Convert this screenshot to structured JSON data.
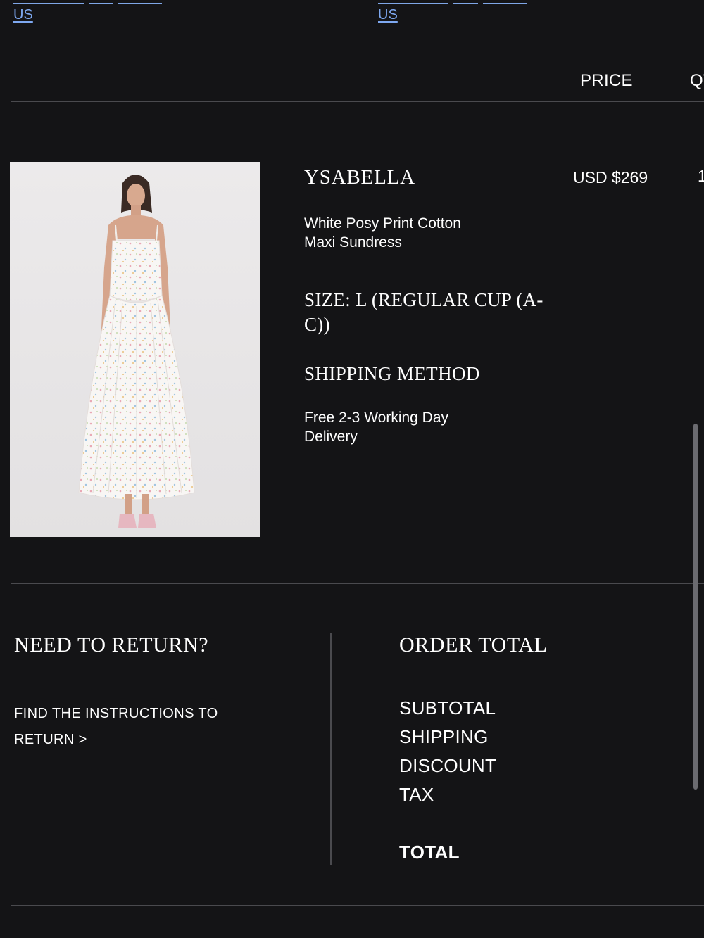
{
  "top_links": [
    "US",
    "US"
  ],
  "table_header": {
    "price": "PRICE",
    "qty": "QT"
  },
  "item": {
    "name": "YSABELLA",
    "description": "White Posy Print Cotton Maxi Sundress",
    "size": "SIZE: L (REGULAR CUP (A-C))",
    "shipping_method_label": "SHIPPING METHOD",
    "shipping_method_value": "Free 2-3 Working Day Delivery",
    "price": "USD $269",
    "qty": "1"
  },
  "returns": {
    "heading": "NEED TO RETURN?",
    "link": "FIND THE INSTRUCTIONS TO RETURN >"
  },
  "order_total": {
    "heading": "ORDER TOTAL",
    "rows": [
      "SUBTOTAL",
      "SHIPPING",
      "DISCOUNT",
      "TAX"
    ],
    "total_label": "TOTAL"
  },
  "colors": {
    "background": "#141416",
    "link": "#7ea8f0",
    "divider": "#4a4a4e",
    "text": "#ffffff"
  }
}
